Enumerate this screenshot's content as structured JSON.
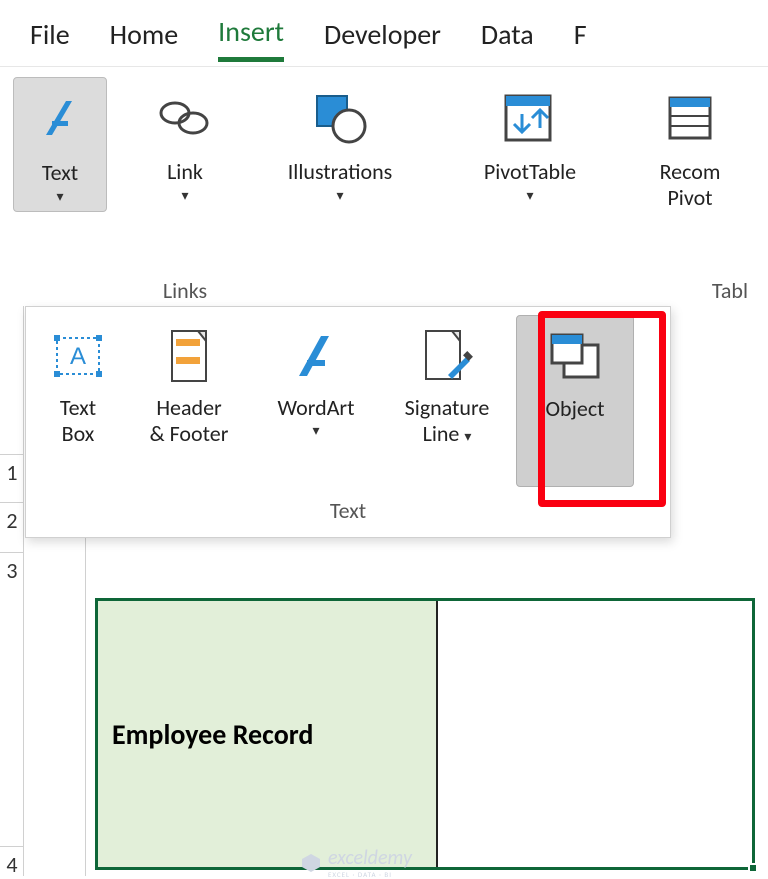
{
  "tabs": {
    "file": "File",
    "home": "Home",
    "insert": "Insert",
    "developer": "Developer",
    "data": "Data",
    "partial": "F"
  },
  "ribbon": {
    "text_btn": "Text",
    "link_btn": "Link",
    "illustrations_btn": "Illustrations",
    "pivottable_btn": "PivotTable",
    "recom_pivot_line1": "Recom",
    "recom_pivot_line2": "Pivot",
    "group_links": "Links",
    "group_tables_partial": "Tabl"
  },
  "gallery": {
    "text_box_l1": "Text",
    "text_box_l2": "Box",
    "header_footer_l1": "Header",
    "header_footer_l2": "& Footer",
    "wordart": "WordArt",
    "signature_l1": "Signature",
    "signature_l2": "Line",
    "object": "Object",
    "group_label": "Text"
  },
  "rows": {
    "r1": "1",
    "r2": "2",
    "r3": "3",
    "r4": "4"
  },
  "cells": {
    "employee_record": "Employee Record"
  },
  "watermark": {
    "name": "exceldemy",
    "sub": "EXCEL · DATA · BI"
  }
}
